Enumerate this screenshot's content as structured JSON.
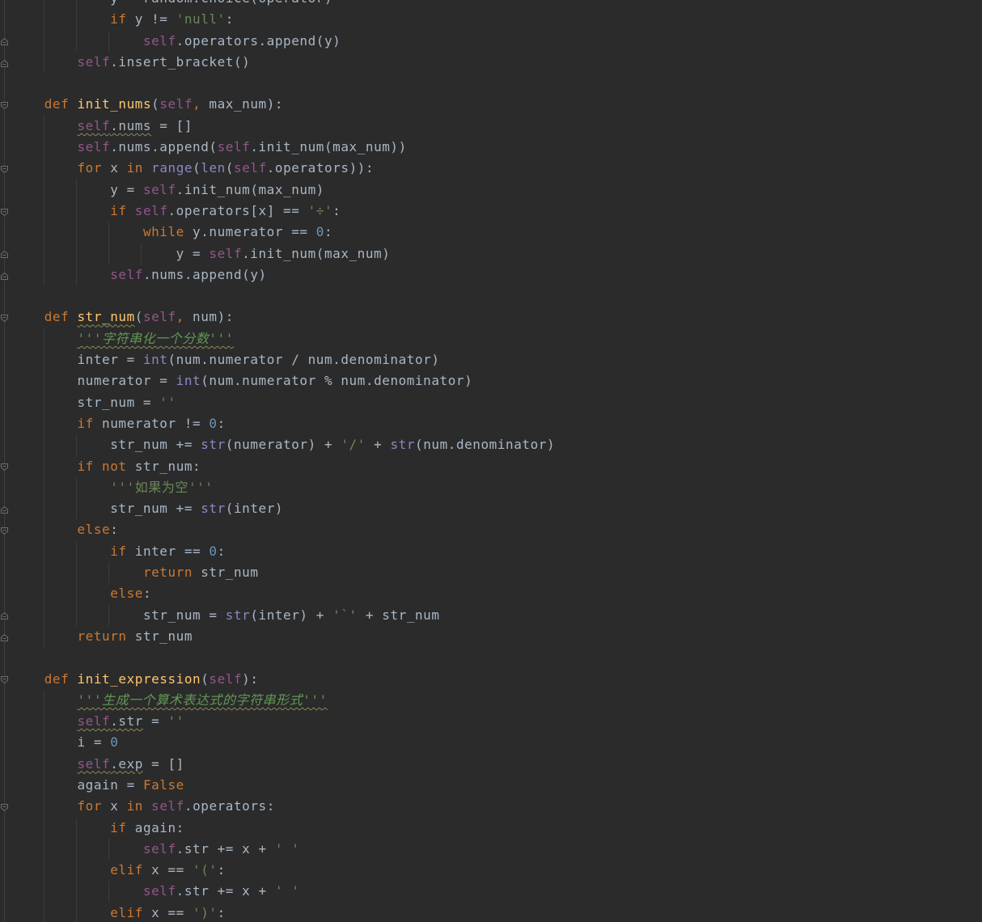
{
  "editor": {
    "language": "python",
    "theme": "darcula",
    "colors": {
      "background": "#2b2b2b",
      "keyword": "#cc7832",
      "self": "#94558d",
      "function": "#ffc66d",
      "builtin": "#8888c6",
      "string": "#6a8759",
      "number": "#6897bb",
      "docstring": "#629755",
      "plain": "#a9b7c6"
    },
    "lines": [
      {
        "indent": 3,
        "tokens": [
          {
            "t": "y = random.choice(operator)",
            "c": "plain"
          }
        ]
      },
      {
        "indent": 3,
        "tokens": [
          {
            "t": "if",
            "c": "kw"
          },
          {
            "t": " y != ",
            "c": "plain"
          },
          {
            "t": "'null'",
            "c": "str"
          },
          {
            "t": ":",
            "c": "plain"
          }
        ]
      },
      {
        "indent": 4,
        "tokens": [
          {
            "t": "self",
            "c": "self"
          },
          {
            "t": ".operators.append(y)",
            "c": "plain"
          }
        ]
      },
      {
        "indent": 2,
        "tokens": [
          {
            "t": "self",
            "c": "self"
          },
          {
            "t": ".insert_bracket()",
            "c": "plain"
          }
        ]
      },
      {
        "indent": 0,
        "tokens": []
      },
      {
        "indent": 1,
        "tokens": [
          {
            "t": "def",
            "c": "kw"
          },
          {
            "t": " ",
            "c": "plain"
          },
          {
            "t": "init_nums",
            "c": "func"
          },
          {
            "t": "(",
            "c": "plain"
          },
          {
            "t": "self",
            "c": "self"
          },
          {
            "t": ",",
            "c": "kw"
          },
          {
            "t": " max_num):",
            "c": "plain"
          }
        ]
      },
      {
        "indent": 2,
        "tokens": [
          {
            "t": "self",
            "c": "self",
            "sq": true
          },
          {
            "t": ".nums",
            "c": "plain",
            "sq": true
          },
          {
            "t": " = []",
            "c": "plain"
          }
        ]
      },
      {
        "indent": 2,
        "tokens": [
          {
            "t": "self",
            "c": "self"
          },
          {
            "t": ".nums.append(",
            "c": "plain"
          },
          {
            "t": "self",
            "c": "self"
          },
          {
            "t": ".init_num(max_num))",
            "c": "plain"
          }
        ]
      },
      {
        "indent": 2,
        "tokens": [
          {
            "t": "for",
            "c": "kw"
          },
          {
            "t": " x ",
            "c": "plain"
          },
          {
            "t": "in",
            "c": "kw"
          },
          {
            "t": " ",
            "c": "plain"
          },
          {
            "t": "range",
            "c": "builtin"
          },
          {
            "t": "(",
            "c": "plain"
          },
          {
            "t": "len",
            "c": "builtin"
          },
          {
            "t": "(",
            "c": "plain"
          },
          {
            "t": "self",
            "c": "self"
          },
          {
            "t": ".operators)):",
            "c": "plain"
          }
        ]
      },
      {
        "indent": 3,
        "tokens": [
          {
            "t": "y = ",
            "c": "plain"
          },
          {
            "t": "self",
            "c": "self"
          },
          {
            "t": ".init_num(max_num)",
            "c": "plain"
          }
        ]
      },
      {
        "indent": 3,
        "tokens": [
          {
            "t": "if",
            "c": "kw"
          },
          {
            "t": " ",
            "c": "plain"
          },
          {
            "t": "self",
            "c": "self"
          },
          {
            "t": ".operators[x] == ",
            "c": "plain"
          },
          {
            "t": "'÷'",
            "c": "str"
          },
          {
            "t": ":",
            "c": "plain"
          }
        ]
      },
      {
        "indent": 4,
        "tokens": [
          {
            "t": "while",
            "c": "kw"
          },
          {
            "t": " y.numerator == ",
            "c": "plain"
          },
          {
            "t": "0",
            "c": "num"
          },
          {
            "t": ":",
            "c": "plain"
          }
        ]
      },
      {
        "indent": 5,
        "tokens": [
          {
            "t": "y = ",
            "c": "plain"
          },
          {
            "t": "self",
            "c": "self"
          },
          {
            "t": ".init_num(max_num)",
            "c": "plain"
          }
        ]
      },
      {
        "indent": 3,
        "tokens": [
          {
            "t": "self",
            "c": "self"
          },
          {
            "t": ".nums.append(y)",
            "c": "plain"
          }
        ]
      },
      {
        "indent": 0,
        "tokens": []
      },
      {
        "indent": 1,
        "tokens": [
          {
            "t": "def",
            "c": "kw"
          },
          {
            "t": " ",
            "c": "plain"
          },
          {
            "t": "str_num",
            "c": "func",
            "sq": true
          },
          {
            "t": "(",
            "c": "plain"
          },
          {
            "t": "self",
            "c": "self"
          },
          {
            "t": ",",
            "c": "kw"
          },
          {
            "t": " num):",
            "c": "plain"
          }
        ]
      },
      {
        "indent": 2,
        "tokens": [
          {
            "t": "'''字符串化一个分数'''",
            "c": "doc",
            "sq": true
          }
        ]
      },
      {
        "indent": 2,
        "tokens": [
          {
            "t": "inter = ",
            "c": "plain"
          },
          {
            "t": "int",
            "c": "builtin"
          },
          {
            "t": "(num.numerator / num.denominator)",
            "c": "plain"
          }
        ]
      },
      {
        "indent": 2,
        "tokens": [
          {
            "t": "numerator = ",
            "c": "plain"
          },
          {
            "t": "int",
            "c": "builtin"
          },
          {
            "t": "(num.numerator % num.denominator)",
            "c": "plain"
          }
        ]
      },
      {
        "indent": 2,
        "tokens": [
          {
            "t": "str_num = ",
            "c": "plain"
          },
          {
            "t": "''",
            "c": "str"
          }
        ]
      },
      {
        "indent": 2,
        "tokens": [
          {
            "t": "if",
            "c": "kw"
          },
          {
            "t": " numerator != ",
            "c": "plain"
          },
          {
            "t": "0",
            "c": "num"
          },
          {
            "t": ":",
            "c": "plain"
          }
        ]
      },
      {
        "indent": 3,
        "tokens": [
          {
            "t": "str_num += ",
            "c": "plain"
          },
          {
            "t": "str",
            "c": "builtin"
          },
          {
            "t": "(numerator) + ",
            "c": "plain"
          },
          {
            "t": "'/'",
            "c": "str"
          },
          {
            "t": " + ",
            "c": "plain"
          },
          {
            "t": "str",
            "c": "builtin"
          },
          {
            "t": "(num.denominator)",
            "c": "plain"
          }
        ]
      },
      {
        "indent": 2,
        "tokens": [
          {
            "t": "if",
            "c": "kw"
          },
          {
            "t": " ",
            "c": "plain"
          },
          {
            "t": "not",
            "c": "kw"
          },
          {
            "t": " str_num:",
            "c": "plain"
          }
        ]
      },
      {
        "indent": 3,
        "tokens": [
          {
            "t": "'''如果为空'''",
            "c": "str"
          }
        ]
      },
      {
        "indent": 3,
        "tokens": [
          {
            "t": "str_num += ",
            "c": "plain"
          },
          {
            "t": "str",
            "c": "builtin"
          },
          {
            "t": "(inter)",
            "c": "plain"
          }
        ]
      },
      {
        "indent": 2,
        "tokens": [
          {
            "t": "else",
            "c": "kw"
          },
          {
            "t": ":",
            "c": "plain"
          }
        ]
      },
      {
        "indent": 3,
        "tokens": [
          {
            "t": "if",
            "c": "kw"
          },
          {
            "t": " inter == ",
            "c": "plain"
          },
          {
            "t": "0",
            "c": "num"
          },
          {
            "t": ":",
            "c": "plain"
          }
        ]
      },
      {
        "indent": 4,
        "tokens": [
          {
            "t": "return",
            "c": "kw"
          },
          {
            "t": " str_num",
            "c": "plain"
          }
        ]
      },
      {
        "indent": 3,
        "tokens": [
          {
            "t": "else",
            "c": "kw"
          },
          {
            "t": ":",
            "c": "plain"
          }
        ]
      },
      {
        "indent": 4,
        "tokens": [
          {
            "t": "str_num = ",
            "c": "plain"
          },
          {
            "t": "str",
            "c": "builtin"
          },
          {
            "t": "(inter) + ",
            "c": "plain"
          },
          {
            "t": "'`'",
            "c": "str"
          },
          {
            "t": " + str_num",
            "c": "plain"
          }
        ]
      },
      {
        "indent": 2,
        "tokens": [
          {
            "t": "return",
            "c": "kw"
          },
          {
            "t": " str_num",
            "c": "plain"
          }
        ]
      },
      {
        "indent": 0,
        "tokens": []
      },
      {
        "indent": 1,
        "tokens": [
          {
            "t": "def",
            "c": "kw"
          },
          {
            "t": " ",
            "c": "plain"
          },
          {
            "t": "init_expression",
            "c": "func"
          },
          {
            "t": "(",
            "c": "plain"
          },
          {
            "t": "self",
            "c": "self"
          },
          {
            "t": "):",
            "c": "plain"
          }
        ]
      },
      {
        "indent": 2,
        "tokens": [
          {
            "t": "'''生成一个算术表达式的字符串形式'''",
            "c": "doc",
            "sq": true
          }
        ]
      },
      {
        "indent": 2,
        "tokens": [
          {
            "t": "self",
            "c": "self",
            "sq": true
          },
          {
            "t": ".str",
            "c": "plain",
            "sq": true
          },
          {
            "t": " = ",
            "c": "plain"
          },
          {
            "t": "''",
            "c": "str"
          }
        ]
      },
      {
        "indent": 2,
        "tokens": [
          {
            "t": "i = ",
            "c": "plain"
          },
          {
            "t": "0",
            "c": "num"
          }
        ]
      },
      {
        "indent": 2,
        "tokens": [
          {
            "t": "self",
            "c": "self",
            "sq": true
          },
          {
            "t": ".exp",
            "c": "plain",
            "sq": true
          },
          {
            "t": " = []",
            "c": "plain"
          }
        ]
      },
      {
        "indent": 2,
        "tokens": [
          {
            "t": "again = ",
            "c": "plain"
          },
          {
            "t": "False",
            "c": "kw"
          }
        ]
      },
      {
        "indent": 2,
        "tokens": [
          {
            "t": "for",
            "c": "kw"
          },
          {
            "t": " x ",
            "c": "plain"
          },
          {
            "t": "in",
            "c": "kw"
          },
          {
            "t": " ",
            "c": "plain"
          },
          {
            "t": "self",
            "c": "self"
          },
          {
            "t": ".operators:",
            "c": "plain"
          }
        ]
      },
      {
        "indent": 3,
        "tokens": [
          {
            "t": "if",
            "c": "kw"
          },
          {
            "t": " again:",
            "c": "plain"
          }
        ]
      },
      {
        "indent": 4,
        "tokens": [
          {
            "t": "self",
            "c": "self"
          },
          {
            "t": ".str += x + ",
            "c": "plain"
          },
          {
            "t": "' '",
            "c": "str"
          }
        ]
      },
      {
        "indent": 3,
        "tokens": [
          {
            "t": "elif",
            "c": "kw"
          },
          {
            "t": " x == ",
            "c": "plain"
          },
          {
            "t": "'('",
            "c": "str"
          },
          {
            "t": ":",
            "c": "plain"
          }
        ]
      },
      {
        "indent": 4,
        "tokens": [
          {
            "t": "self",
            "c": "self"
          },
          {
            "t": ".str += x + ",
            "c": "plain"
          },
          {
            "t": "' '",
            "c": "str"
          }
        ]
      },
      {
        "indent": 3,
        "tokens": [
          {
            "t": "elif",
            "c": "kw"
          },
          {
            "t": " x == ",
            "c": "plain"
          },
          {
            "t": "')'",
            "c": "str"
          },
          {
            "t": ":",
            "c": "plain"
          }
        ]
      }
    ],
    "fold_markers": [
      {
        "line": 2,
        "type": "end"
      },
      {
        "line": 3,
        "type": "end"
      },
      {
        "line": 5,
        "type": "start"
      },
      {
        "line": 8,
        "type": "start"
      },
      {
        "line": 10,
        "type": "start"
      },
      {
        "line": 12,
        "type": "end"
      },
      {
        "line": 13,
        "type": "end"
      },
      {
        "line": 15,
        "type": "start"
      },
      {
        "line": 22,
        "type": "start"
      },
      {
        "line": 24,
        "type": "end"
      },
      {
        "line": 25,
        "type": "start"
      },
      {
        "line": 29,
        "type": "end"
      },
      {
        "line": 30,
        "type": "end"
      },
      {
        "line": 32,
        "type": "start"
      },
      {
        "line": 38,
        "type": "start"
      }
    ]
  }
}
